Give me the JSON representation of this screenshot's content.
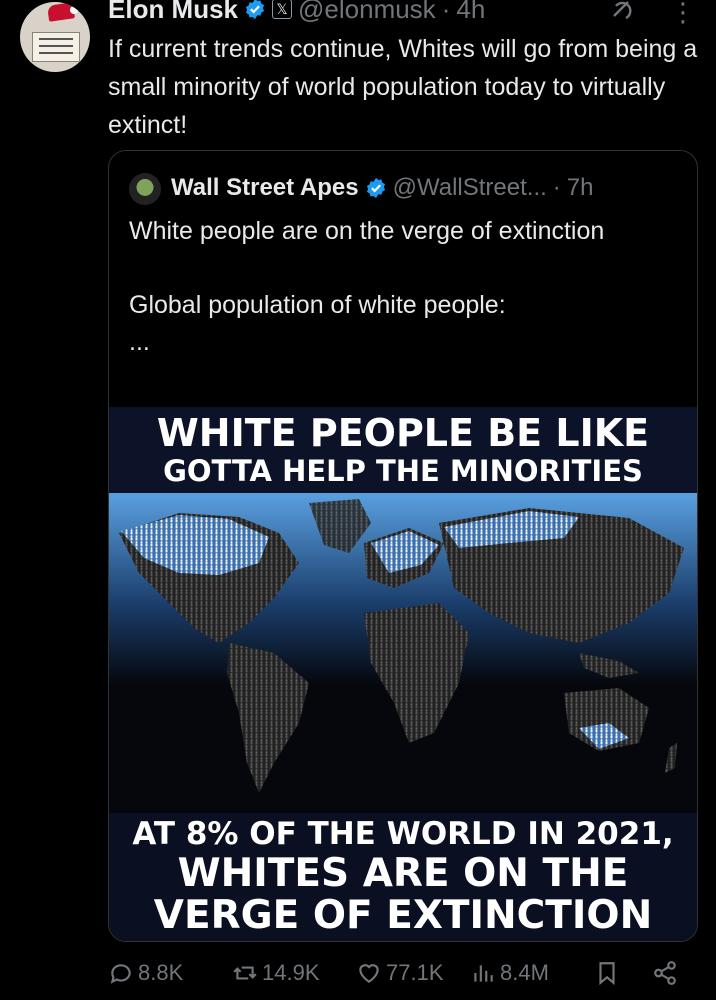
{
  "tweet": {
    "author_name": "Elon Musk",
    "x_badge": "𝕏",
    "handle": "@elonmusk",
    "separator": "·",
    "time": "4h",
    "text": "If current trends continue, Whites will go from being a small minority of world population today to virtually extinct!"
  },
  "quoted": {
    "author_name": "Wall Street Apes",
    "handle": "@WallStreet...",
    "separator": "·",
    "time": "7h",
    "text_line1": "White people are on the verge of extinction",
    "text_line2": "Global population of white people:",
    "text_line3": "...",
    "meme": {
      "top_line1": "WHITE PEOPLE BE LIKE",
      "top_line2": "GOTTA HELP THE MINORITIES",
      "bottom_line1": "AT 8% OF THE WORLD IN 2021,",
      "bottom_line2": "WHITES ARE ON THE",
      "bottom_line3": "VERGE OF EXTINCTION"
    }
  },
  "actions": {
    "replies": "8.8K",
    "reposts": "14.9K",
    "likes": "77.1K",
    "views": "8.4M"
  },
  "colors": {
    "background": "#000000",
    "text": "#e7e9ea",
    "muted": "#71767b",
    "verified": "#1d9bf0",
    "border": "#2f3336"
  },
  "icons": [
    "verified-badge-icon",
    "grok-icon",
    "more-icon",
    "reply-icon",
    "repost-icon",
    "like-icon",
    "views-icon",
    "bookmark-icon",
    "share-icon"
  ]
}
